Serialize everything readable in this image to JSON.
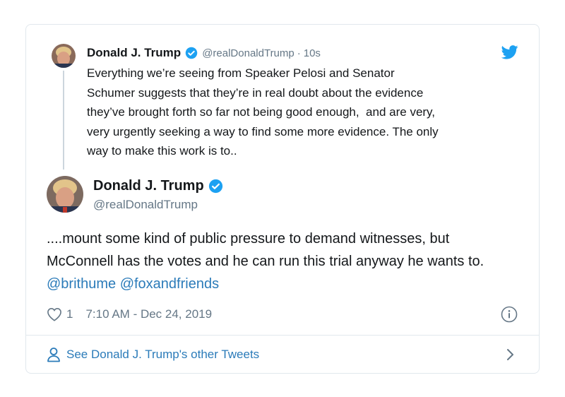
{
  "parent_tweet": {
    "name": "Donald J. Trump",
    "handle": "@realDonaldTrump",
    "separator": "·",
    "time": "10s",
    "text": "Everything we’re seeing from Speaker Pelosi and Senator\nSchumer suggests that they’re in real doubt about the evidence\nthey’ve brought forth so far not being good enough,  and are very,\nvery urgently seeking a way to find some more evidence. The only\nway to make this work is to.."
  },
  "main_tweet": {
    "name": "Donald J. Trump",
    "handle": "@realDonaldTrump",
    "text_part1": "....mount some kind of public pressure to demand witnesses, but McConnell has the votes and he can run this trial anyway he wants to. ",
    "mention1": "@brithume",
    "mention2": "@foxandfriends",
    "like_count": "1",
    "timestamp": "7:10 AM - Dec 24, 2019"
  },
  "footer": {
    "link_label": "See Donald J. Trump's other Tweets"
  },
  "icons": {
    "verified": "verified-badge-icon",
    "brand": "twitter-bird-icon",
    "like": "heart-icon",
    "info": "info-icon",
    "profile": "person-icon",
    "chevron": "chevron-right-icon"
  },
  "colors": {
    "twitter_blue": "#1da1f2",
    "link_blue": "#2b7bb9",
    "secondary_text": "#657786",
    "border": "#e1e8ed"
  }
}
